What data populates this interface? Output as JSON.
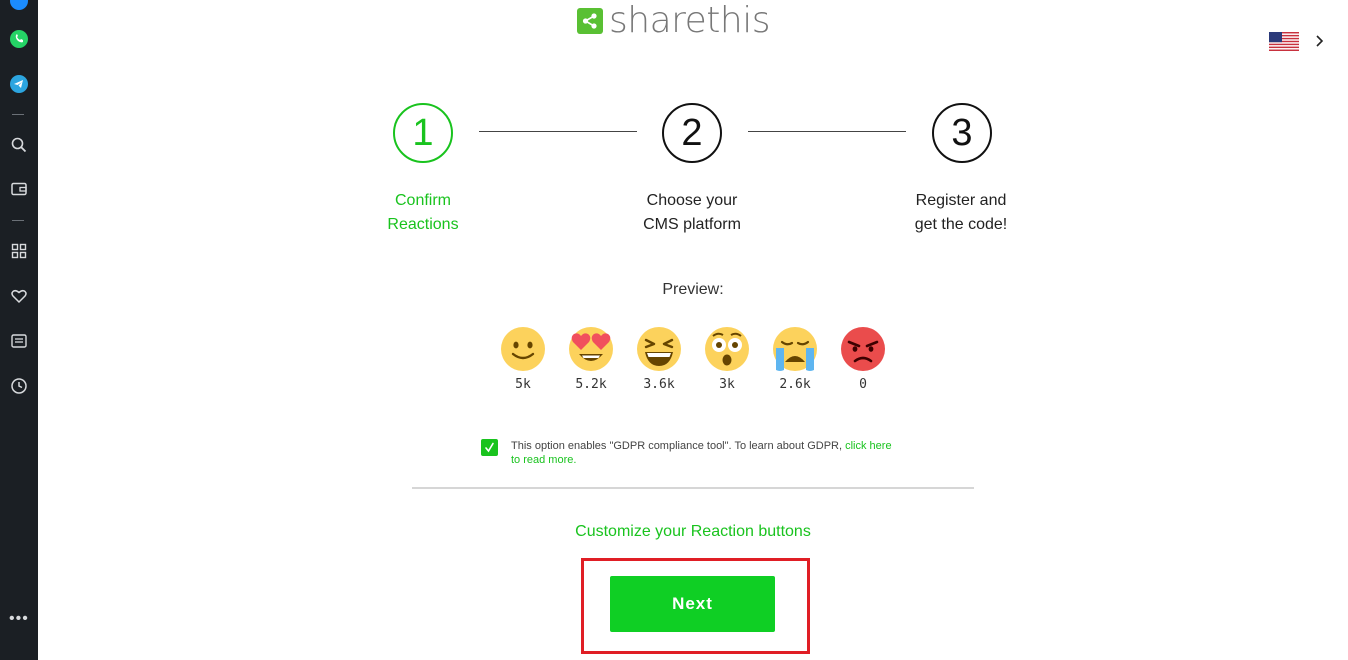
{
  "brand": {
    "name": "sharethis",
    "color": "#59c033"
  },
  "header": {
    "language_flag": "us-flag-icon"
  },
  "sidebar": {
    "items": [
      {
        "name": "messenger-icon"
      },
      {
        "name": "whatsapp-icon"
      },
      {
        "name": "telegram-icon"
      },
      {
        "name": "search-icon"
      },
      {
        "name": "wallet-icon"
      },
      {
        "name": "apps-grid-icon"
      },
      {
        "name": "heart-icon"
      },
      {
        "name": "news-icon"
      },
      {
        "name": "history-icon"
      },
      {
        "name": "more-icon"
      }
    ]
  },
  "steps": [
    {
      "number": "1",
      "line1": "Confirm",
      "line2": "Reactions",
      "active": true
    },
    {
      "number": "2",
      "line1": "Choose your",
      "line2": "CMS platform",
      "active": false
    },
    {
      "number": "3",
      "line1": "Register and",
      "line2": "get the code!",
      "active": false
    }
  ],
  "preview": {
    "label": "Preview:",
    "reactions": [
      {
        "name": "slight-smile",
        "count": "5k"
      },
      {
        "name": "heart-eyes",
        "count": "5.2k"
      },
      {
        "name": "laughing",
        "count": "3.6k"
      },
      {
        "name": "surprised",
        "count": "3k"
      },
      {
        "name": "crying",
        "count": "2.6k"
      },
      {
        "name": "angry",
        "count": "0"
      }
    ]
  },
  "gdpr": {
    "checked": true,
    "text": "This option enables \"GDPR compliance tool\". To learn about GDPR, ",
    "link_text": "click here to read more."
  },
  "customize_link": "Customize your Reaction buttons",
  "next_button": "Next",
  "colors": {
    "accent": "#19c31e",
    "button": "#0fcf24",
    "highlight": "#e01e25"
  }
}
